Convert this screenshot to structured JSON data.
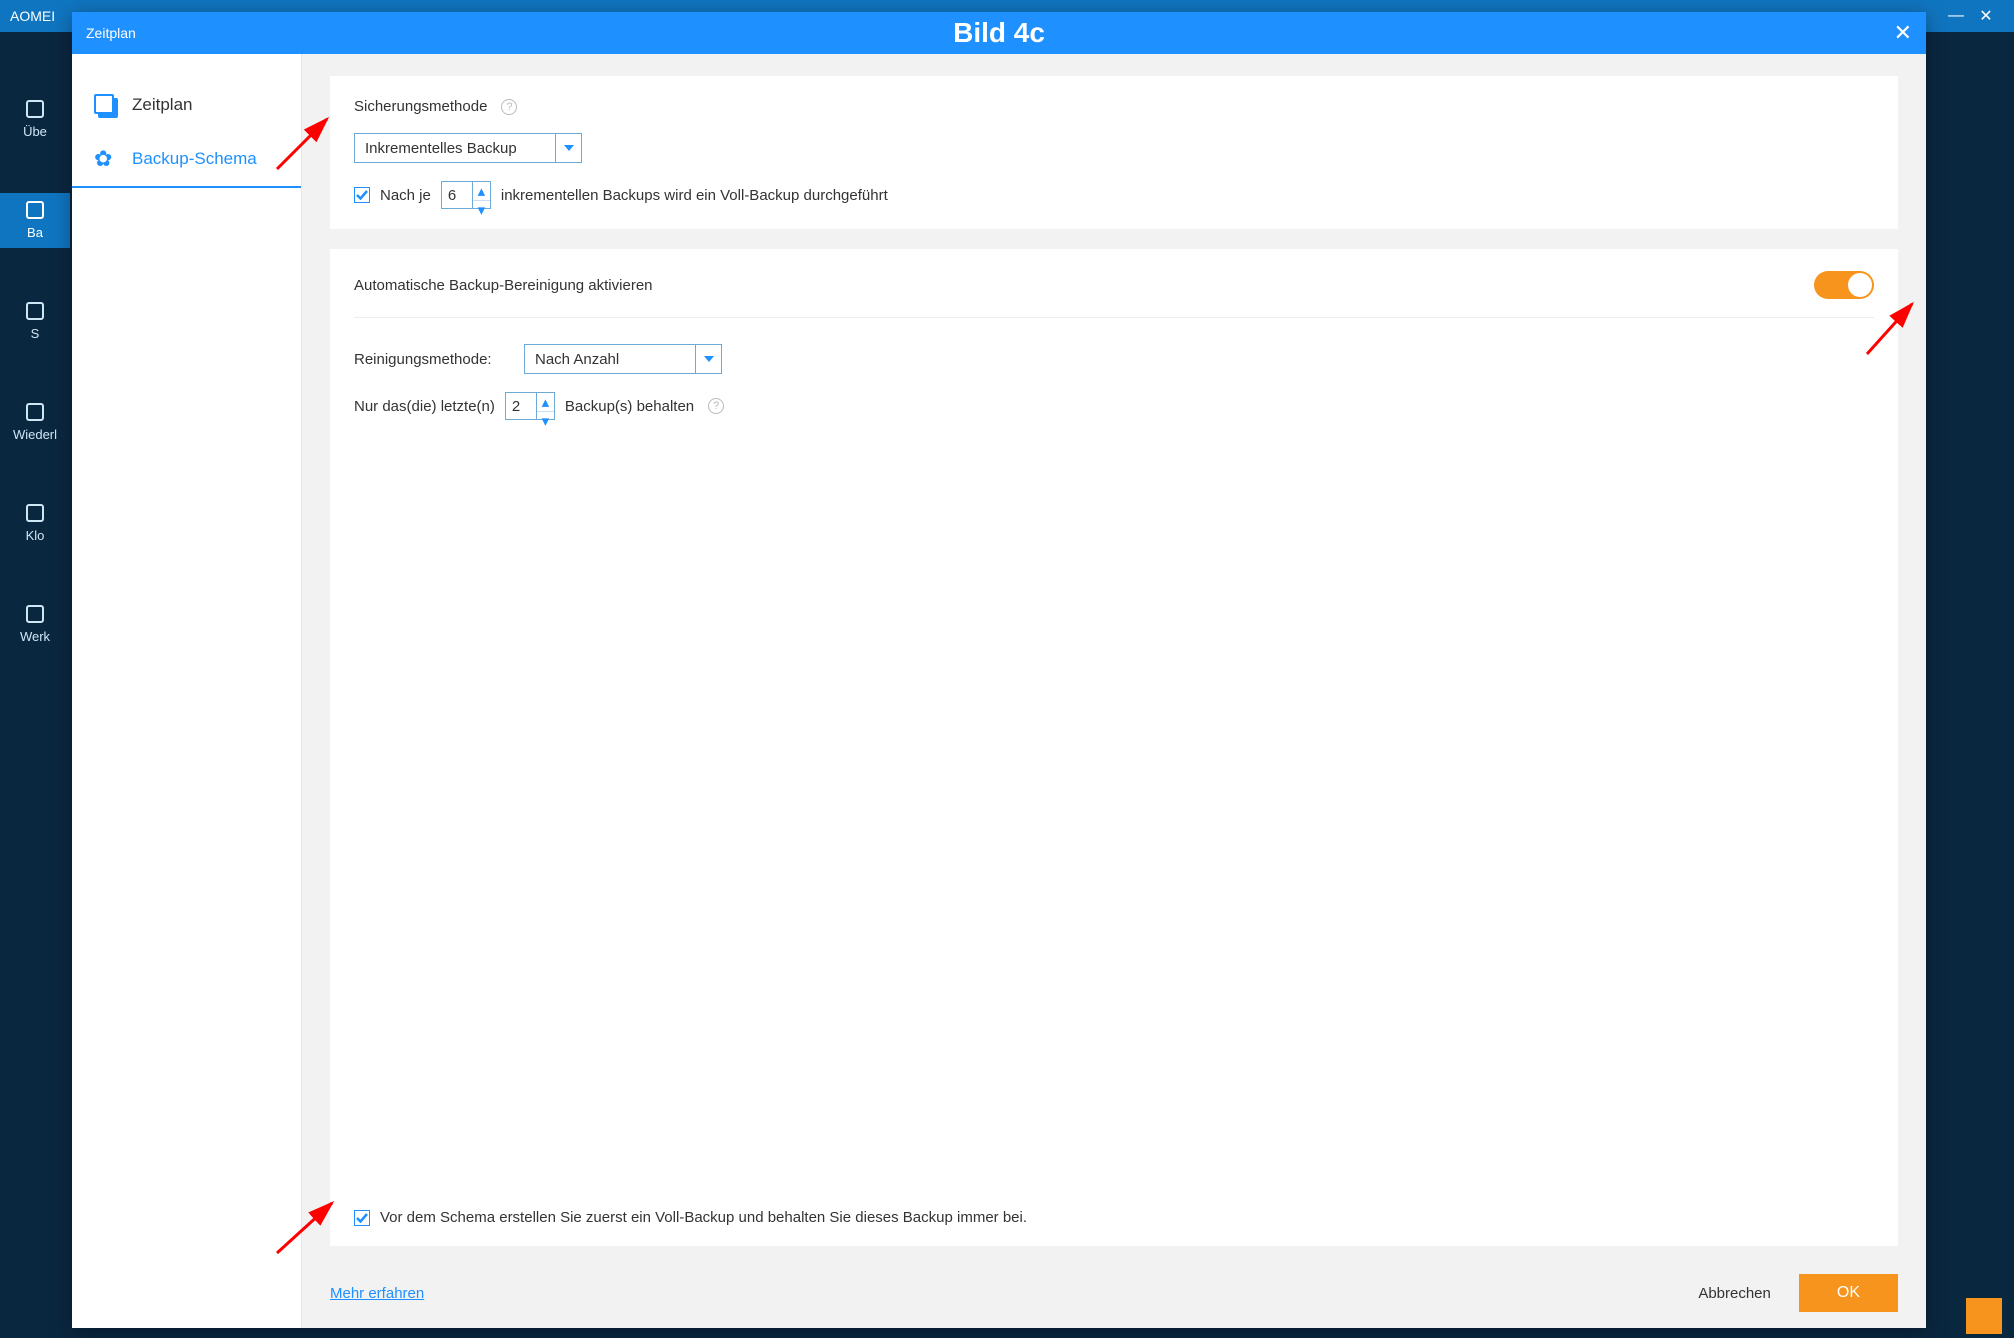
{
  "app": {
    "title": "AOMEI",
    "nav": [
      "Übe",
      "Ba",
      "S",
      "Wiederl",
      "Klo",
      "Werk"
    ]
  },
  "dialog": {
    "headerLeft": "Zeitplan",
    "headerCenter": "Bild 4c",
    "tabs": {
      "schedule": "Zeitplan",
      "schema": "Backup-Schema"
    },
    "panel1": {
      "methodLabel": "Sicherungsmethode",
      "methodValue": "Inkrementelles Backup",
      "afterEachPre": "Nach je",
      "afterEachCount": "6",
      "afterEachPost": "inkrementellen Backups wird ein Voll-Backup durchgeführt"
    },
    "panel2": {
      "autoCleanLabel": "Automatische Backup-Bereinigung aktivieren",
      "cleanMethodLabel": "Reinigungsmethode:",
      "cleanMethodValue": "Nach Anzahl",
      "keepPre": "Nur das(die) letzte(n)",
      "keepCount": "2",
      "keepPost": "Backup(s) behalten",
      "preschemaNote": "Vor dem Schema erstellen Sie zuerst ein Voll-Backup und behalten Sie dieses Backup immer bei."
    },
    "footer": {
      "learnMore": "Mehr erfahren",
      "cancel": "Abbrechen",
      "ok": "OK"
    }
  }
}
